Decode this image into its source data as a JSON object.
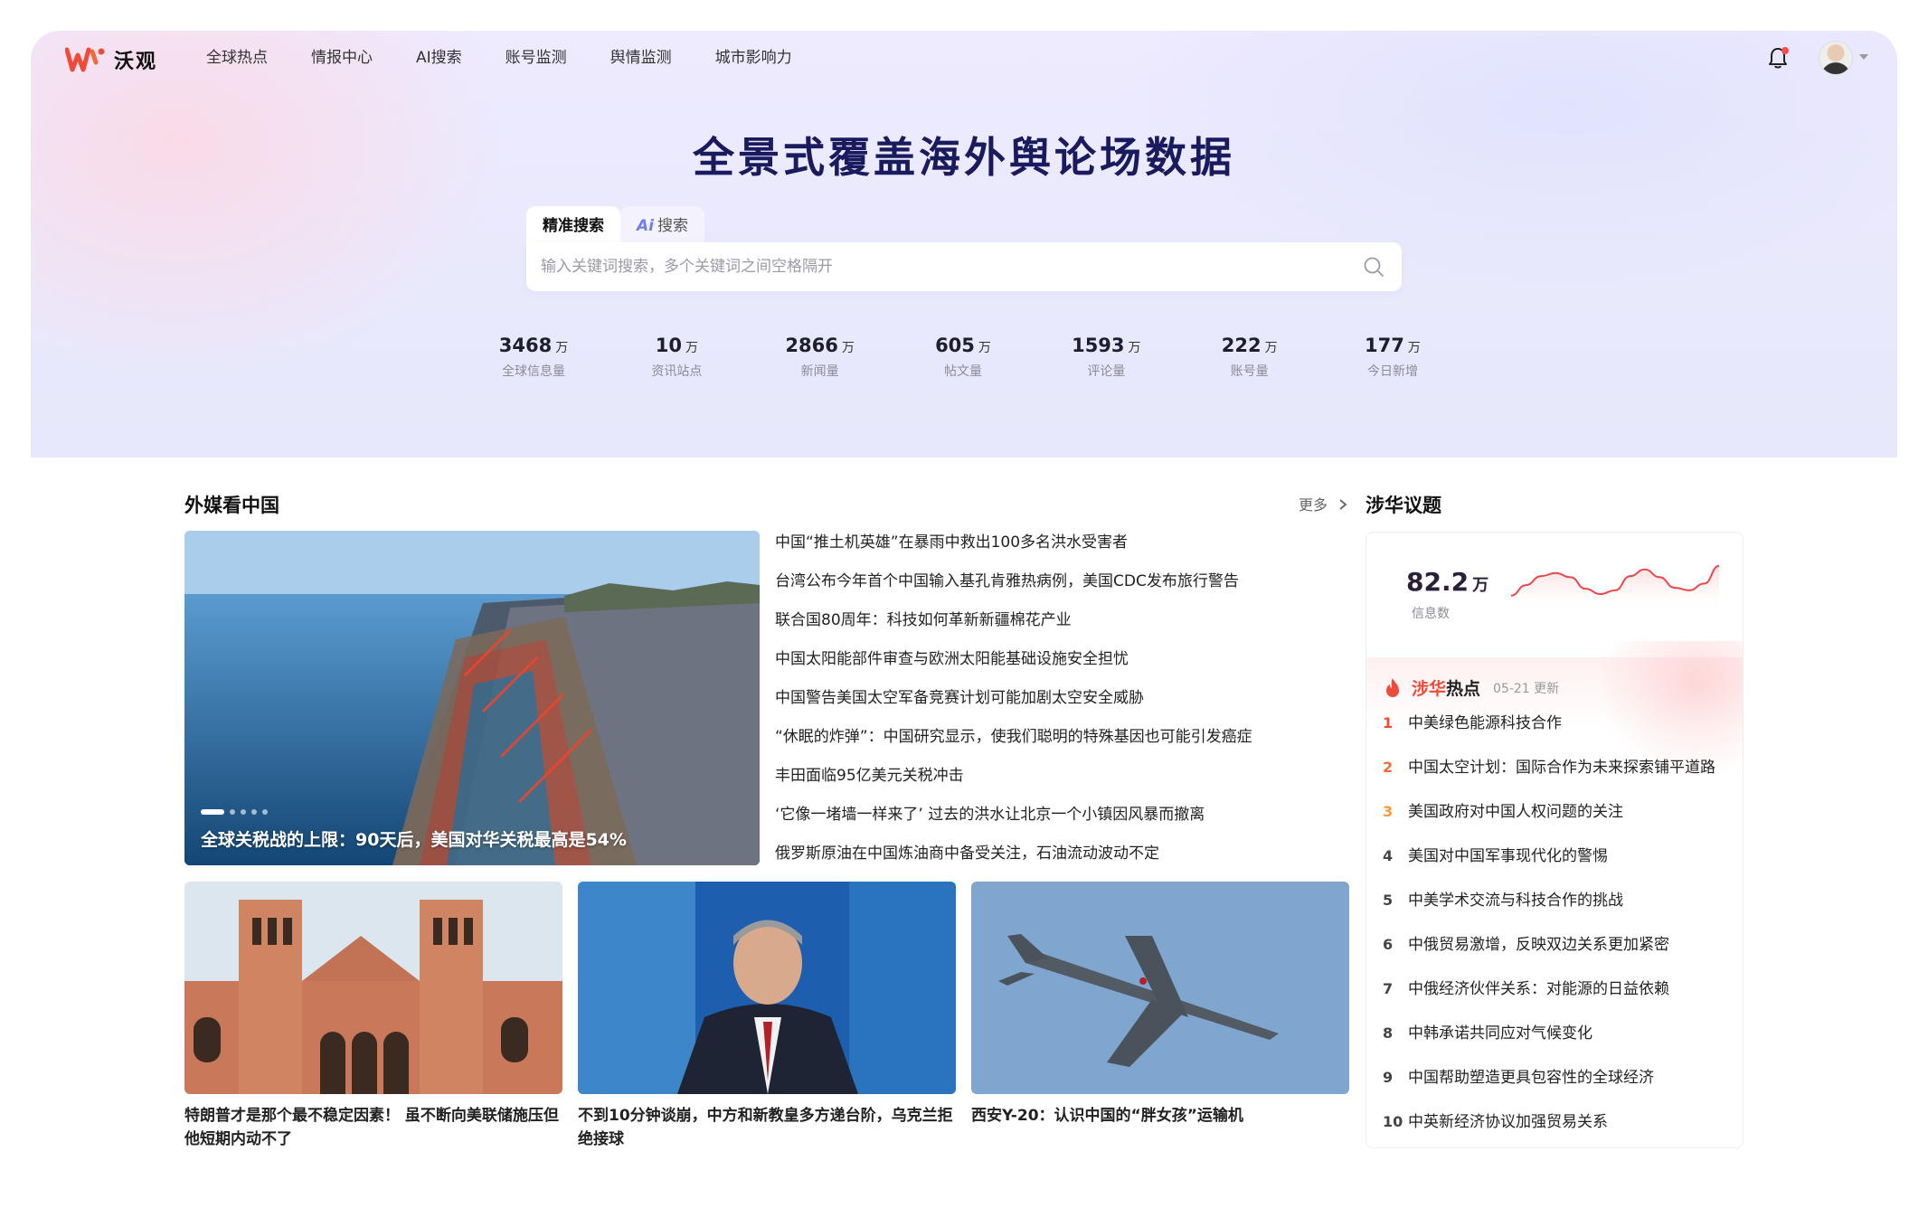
{
  "app": {
    "name": "沃观"
  },
  "nav": {
    "items": [
      "全球热点",
      "情报中心",
      "AI搜索",
      "账号监测",
      "舆情监测",
      "城市影响力"
    ]
  },
  "hero": {
    "title": "全景式覆盖海外舆论场数据"
  },
  "search": {
    "tabs": [
      {
        "label": "精准搜索",
        "active": true
      },
      {
        "prefix": "Ai",
        "label": "搜索",
        "active": false
      }
    ],
    "placeholder": "输入关键词搜索，多个关键词之间空格隔开",
    "value": ""
  },
  "stats": [
    {
      "value": "3468",
      "unit": "万",
      "label": "全球信息量"
    },
    {
      "value": "10",
      "unit": "万",
      "label": "资讯站点"
    },
    {
      "value": "2866",
      "unit": "万",
      "label": "新闻量"
    },
    {
      "value": "605",
      "unit": "万",
      "label": "帖文量"
    },
    {
      "value": "1593",
      "unit": "万",
      "label": "评论量"
    },
    {
      "value": "222",
      "unit": "万",
      "label": "账号量"
    },
    {
      "value": "177",
      "unit": "万",
      "label": "今日新增"
    }
  ],
  "foreign_media": {
    "title": "外媒看中国",
    "more_label": "更多",
    "featured": {
      "caption": "全球关税战的上限：90天后，美国对华关税最高是54%",
      "slide_count": 5,
      "active_slide": 1
    },
    "news": [
      "中国“推土机英雄”在暴雨中救出100多名洪水受害者",
      "台湾公布今年首个中国输入基孔肯雅热病例，美国CDC发布旅行警告",
      "联合国80周年：科技如何革新新疆棉花产业",
      "中国太阳能部件审查与欧洲太阳能基础设施安全担忧",
      "中国警告美国太空军备竞赛计划可能加剧太空安全威胁",
      "“休眠的炸弹”：中国研究显示，使我们聪明的特殊基因也可能引发癌症",
      "丰田面临95亿美元关税冲击",
      "‘它像一堵墙一样来了’ 过去的洪水让北京一个小镇因风暴而撤离",
      "俄罗斯原油在中国炼油商中备受关注，石油流动波动不定"
    ],
    "cards": [
      {
        "title": "特朗普才是那个最不稳定因素！ 虽不断向美联储施压但他短期内动不了",
        "image": "university-building"
      },
      {
        "title": "不到10分钟谈崩，中方和新教皇多方递台阶，乌克兰拒绝接球",
        "image": "tv-commentator"
      },
      {
        "title": "西安Y-20：认识中国的“胖女孩”运输机",
        "image": "transport-aircraft"
      }
    ]
  },
  "china_topics": {
    "title": "涉华议题",
    "metric": {
      "value": "82.2",
      "unit": "万",
      "label": "信息数"
    },
    "sparkline": [
      0.35,
      0.55,
      0.72,
      0.78,
      0.7,
      0.48,
      0.38,
      0.45,
      0.72,
      0.85,
      0.7,
      0.5,
      0.45,
      0.58,
      0.92
    ],
    "hot": {
      "title_a": "涉华",
      "title_b": "热点",
      "date": "05-21 更新",
      "items": [
        "中美绿色能源科技合作",
        "中国太空计划：国际合作为未来探索铺平道路",
        "美国政府对中国人权问题的关注",
        "美国对中国军事现代化的警惕",
        "中美学术交流与科技合作的挑战",
        "中俄贸易激增，反映双边关系更加紧密",
        "中俄经济伙伴关系：对能源的日益依赖",
        "中韩承诺共同应对气候变化",
        "中国帮助塑造更具包容性的全球经济",
        "中英新经济协议加强贸易关系"
      ]
    }
  },
  "colors": {
    "accent_red": "#f04b3a",
    "title_navy": "#1a1a5e",
    "spark_line": "#e8474b"
  }
}
